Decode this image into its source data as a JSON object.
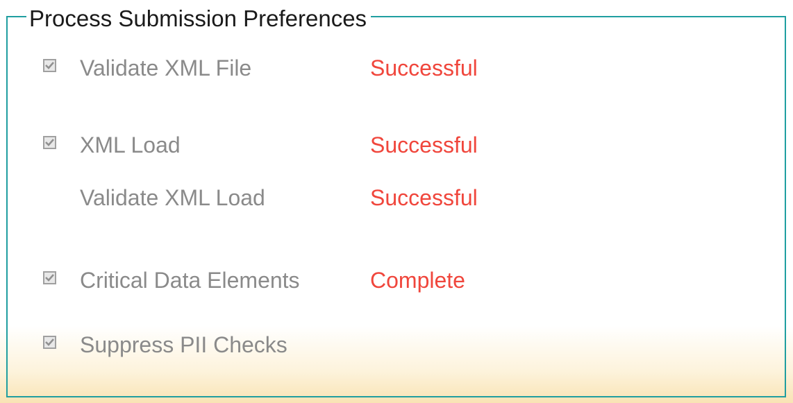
{
  "fieldset": {
    "legend": "Process Submission Preferences"
  },
  "rows": [
    {
      "label": "Validate XML File",
      "checked": true,
      "status": "Successful"
    },
    {
      "label": "XML Load",
      "checked": true,
      "status": "Successful"
    },
    {
      "label": "Validate XML Load",
      "checked": null,
      "status": "Successful"
    },
    {
      "label": "Critical Data Elements",
      "checked": true,
      "status": "Complete"
    },
    {
      "label": "Suppress PII Checks",
      "checked": true,
      "status": ""
    }
  ],
  "colors": {
    "border": "#1f9ea0",
    "status_text": "#f0463c",
    "disabled_text": "#8a8a8a",
    "gradient_bottom": "#f9e3b4"
  }
}
